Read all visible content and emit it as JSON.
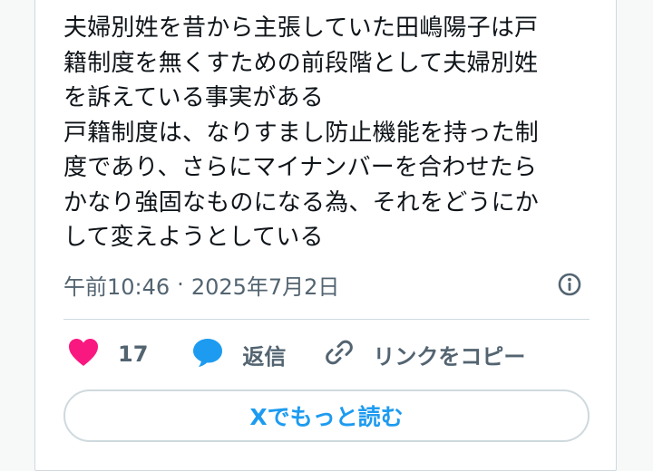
{
  "tweet": {
    "lines": [
      "夫婦別姓を昔から主張していた田嶋陽子は戸",
      "籍制度を無くすための前段階として夫婦別姓",
      "を訴えている事実がある",
      "戸籍制度は、なりすまし防止機能を持った制",
      "度であり、さらにマイナンバーを合わせたら",
      "かなり強固なものになる為、それをどうにか",
      "して変えようとしている"
    ],
    "time": "午前10:46",
    "separator": "·",
    "date": "2025年7月2日"
  },
  "actions": {
    "like_count": "17",
    "reply_label": "返信",
    "copy_link_label": "リンクをコピー"
  },
  "read_more_label": "Xでもっと読む",
  "icons": {
    "like": "heart-icon",
    "reply": "speech-bubble-icon",
    "copy": "link-icon",
    "info": "info-icon"
  },
  "colors": {
    "heart": "#f91880",
    "reply": "#1d9bf0",
    "link_text": "#1d9bf0",
    "muted": "#536471",
    "text": "#0f1419",
    "border": "#cfd9de"
  }
}
